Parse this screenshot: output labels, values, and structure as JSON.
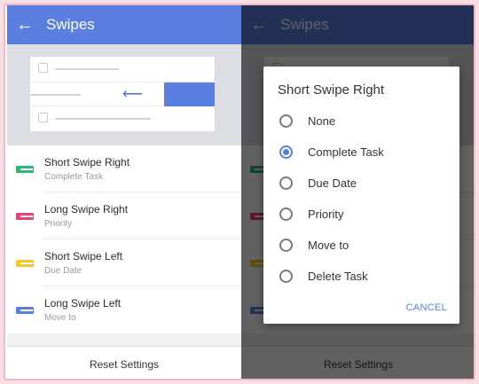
{
  "screen": {
    "title": "Swipes",
    "back_icon": "arrow-left-icon",
    "items": [
      {
        "label": "Short Swipe Right",
        "value": "Complete Task",
        "color": "#2eb872"
      },
      {
        "label": "Long Swipe Right",
        "value": "Priority",
        "color": "#e8417c"
      },
      {
        "label": "Short Swipe Left",
        "value": "Due Date",
        "color": "#f6c72d"
      },
      {
        "label": "Long Swipe Left",
        "value": "Move to",
        "color": "#5b7fe0"
      }
    ],
    "reset_label": "Reset Settings"
  },
  "dialog": {
    "title": "Short Swipe Right",
    "options": [
      {
        "label": "None",
        "selected": false
      },
      {
        "label": "Complete Task",
        "selected": true
      },
      {
        "label": "Due Date",
        "selected": false
      },
      {
        "label": "Priority",
        "selected": false
      },
      {
        "label": "Move to",
        "selected": false
      },
      {
        "label": "Delete Task",
        "selected": false
      }
    ],
    "cancel_label": "CANCEL"
  },
  "colors": {
    "accent": "#5b7fe0",
    "appbar": "#5b7fe0"
  }
}
